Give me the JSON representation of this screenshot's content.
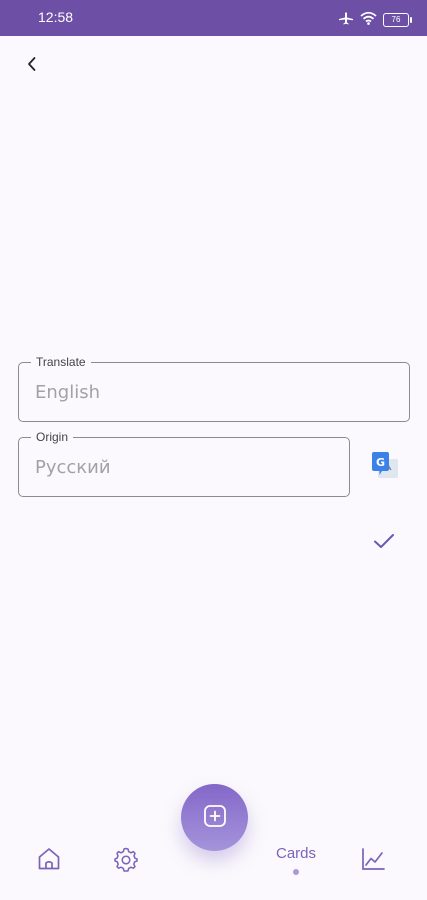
{
  "status_bar": {
    "time": "12:58",
    "battery": "76",
    "color": "#6e4fa6"
  },
  "header": {
    "back_icon": "chevron-left-icon"
  },
  "form": {
    "translate": {
      "label": "Translate",
      "placeholder": "English"
    },
    "origin": {
      "label": "Origin",
      "placeholder": "Русский"
    },
    "translate_action_icon": "google-translate-icon",
    "confirm_icon": "check-icon"
  },
  "bottom_nav": {
    "items": [
      {
        "icon": "home-icon"
      },
      {
        "icon": "gear-icon"
      },
      {
        "label": "Cards",
        "active": true
      },
      {
        "icon": "chart-line-icon"
      }
    ],
    "fab_icon": "plus-square-icon",
    "accent": "#7a63b8"
  }
}
